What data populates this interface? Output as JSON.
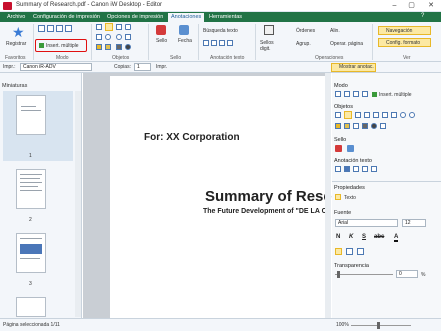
{
  "window": {
    "title": "Summary of Research.pdf - Canon iW Desktop - Editor",
    "min": "–",
    "max": "▢",
    "close": "✕"
  },
  "menu": {
    "tabs": [
      "Archivo",
      "Configuración de impresión",
      "Opciones de impresión",
      "Anotaciones",
      "Herramientas"
    ],
    "active": "Anotaciones"
  },
  "ribbon": {
    "registrar": "Registrar",
    "insert_multiple": "Insert. múltiple",
    "sello": "Sello",
    "fecha": "Fecha",
    "busqueda": "Búsqueda texto",
    "sellos_digit": "Sellos\ndigit.",
    "ordenes": "Órdenes",
    "alin": "Alin.",
    "agrup": "Agrup.",
    "operar_pagina": "Operar. página",
    "navegacion": "Navegación",
    "config_formato": "Config. formato",
    "groups": [
      "Favoritos",
      "Modo",
      "Objetos",
      "Sello",
      "Anotación texto",
      "Operaciones",
      "Ver"
    ],
    "mostrar_anotac": "Mostrar anotac."
  },
  "toolbar2": {
    "printer_label": "Impr.:",
    "printer_value": "Canon iR-ADV",
    "copies_label": "Copias:",
    "copies_value": "1",
    "print_btn": "Impr."
  },
  "left_panel": {
    "title": "Miniaturas",
    "pages": [
      "1",
      "2",
      "3"
    ]
  },
  "document": {
    "for_line": "For: XX Corporation",
    "heading": "Summary of Rese",
    "subheading": "The Future Development of \"DE LA C"
  },
  "right_panel": {
    "modo": "Modo",
    "insert_multiple": "Insert. múltiple",
    "objetos": "Objetos",
    "sello": "Sello",
    "anotacion_texto": "Anotación texto",
    "propiedades": "Propiedades",
    "texto": "Texto",
    "fuente": "Fuente",
    "font_name": "Arial",
    "font_size": "12",
    "transparencia": "Transparencia",
    "transparencia_value": "0",
    "percent": "%"
  },
  "status": {
    "selection": "Página seleccionada 1/11",
    "zoom": "100%"
  },
  "colors": {
    "menubar": "#217346",
    "accent_blue": "#1e5e9a",
    "highlight": "#fce9a3",
    "red_box": "#e01010"
  }
}
